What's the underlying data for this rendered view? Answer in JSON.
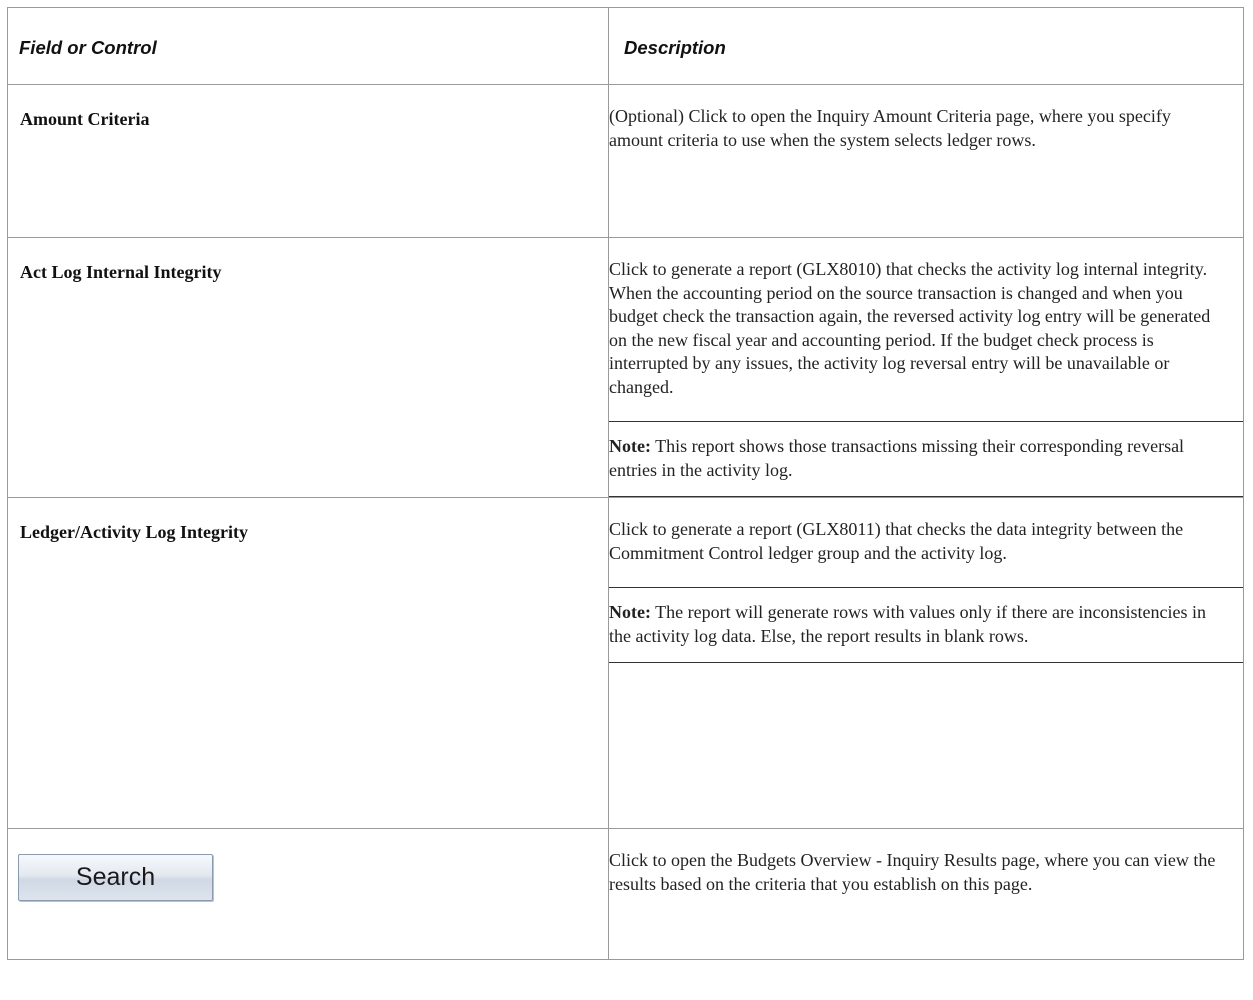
{
  "table": {
    "headers": {
      "field": "Field or Control",
      "description": "Description"
    },
    "rows": [
      {
        "field": "Amount Criteria",
        "description": "(Optional) Click to open the Inquiry Amount Criteria page, where you specify amount criteria to use when the system selects ledger rows."
      },
      {
        "field": "Act Log Internal Integrity",
        "description": "Click to generate a report (GLX8010) that checks the activity log internal integrity. When the accounting period on the source transaction is changed and when you budget check the transaction again, the reversed activity log entry will be generated on the new fiscal year and accounting period. If the budget check process is interrupted by any issues, the activity log reversal entry will be unavailable or changed.",
        "note_label": "Note:",
        "note_text": "This report shows those transactions missing their corresponding reversal entries in the activity log."
      },
      {
        "field": "Ledger/Activity Log Integrity",
        "description": "Click to generate a report (GLX8011) that checks the data integrity between the Commitment Control ledger group and the activity log.",
        "note_label": "Note:",
        "note_text": "The report will generate rows with values only if there are inconsistencies in the activity log data. Else, the report results in blank rows."
      },
      {
        "button_label": "Search",
        "description": "Click to open the Budgets Overview - Inquiry Results page, where you can view the results based on the criteria that you establish on this page."
      }
    ]
  }
}
